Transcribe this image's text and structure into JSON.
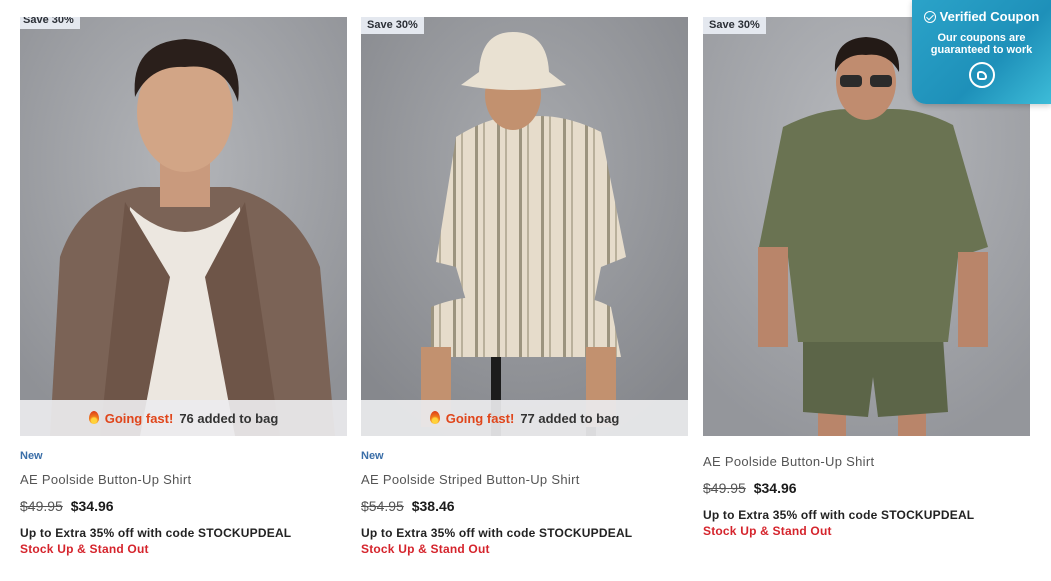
{
  "products": [
    {
      "badge": "Save 30%",
      "urgency_label": "Going fast!",
      "urgency_count": "76 added to bag",
      "flag": "New",
      "name": "AE Poolside Button-Up Shirt",
      "old_price": "$49.95",
      "price": "$34.96",
      "promo": "Up to Extra 35% off with code STOCKUPDEAL",
      "promo_tag": "Stock Up & Stand Out",
      "image_icon": "model-photo-brown-shirt"
    },
    {
      "badge": "Save 30%",
      "urgency_label": "Going fast!",
      "urgency_count": "77 added to bag",
      "flag": "New",
      "name": "AE Poolside Striped Button-Up Shirt",
      "old_price": "$54.95",
      "price": "$38.46",
      "promo": "Up to Extra 35% off with code STOCKUPDEAL",
      "promo_tag": "Stock Up & Stand Out",
      "image_icon": "model-photo-striped-set"
    },
    {
      "badge": "Save 30%",
      "name": "AE Poolside Button-Up Shirt",
      "old_price": "$49.95",
      "price": "$34.96",
      "promo": "Up to Extra 35% off with code STOCKUPDEAL",
      "promo_tag": "Stock Up & Stand Out",
      "image_icon": "model-photo-olive-set"
    }
  ],
  "coupon": {
    "title": "Verified Coupon",
    "subtitle": "Our coupons are guaranteed to work",
    "icon": "coupon-logo-icon"
  },
  "colors": {
    "sale_red": "#d5242c",
    "new_blue": "#3a6ea8",
    "urgency_orange": "#e0451a",
    "coupon_teal": "#2ba3c9"
  }
}
